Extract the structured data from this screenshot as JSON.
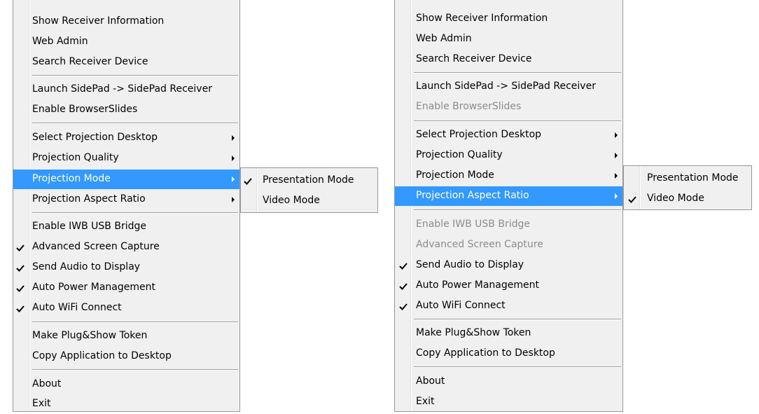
{
  "left_menu": {
    "items": [
      {
        "label": "Show Receiver Information"
      },
      {
        "label": "Web Admin"
      },
      {
        "label": "Search Receiver Device"
      },
      {
        "label": "Launch SidePad -> SidePad Receiver"
      },
      {
        "label": "Enable BrowserSlides"
      },
      {
        "label": "Select Projection Desktop"
      },
      {
        "label": "Projection Quality"
      },
      {
        "label": "Projection Mode"
      },
      {
        "label": "Projection Aspect Ratio"
      },
      {
        "label": "Enable IWB USB Bridge"
      },
      {
        "label": "Advanced Screen Capture",
        "checked": true
      },
      {
        "label": "Send Audio to Display",
        "checked": true
      },
      {
        "label": "Auto Power Management",
        "checked": true
      },
      {
        "label": "Auto WiFi Connect",
        "checked": true
      },
      {
        "label": "Make Plug&Show Token"
      },
      {
        "label": "Copy Application to Desktop"
      },
      {
        "label": "About"
      },
      {
        "label": "Exit"
      }
    ],
    "submenu": [
      {
        "label": "Presentation Mode",
        "checked": true
      },
      {
        "label": "Video Mode"
      }
    ]
  },
  "right_menu": {
    "items": [
      {
        "label": "Show Receiver Information"
      },
      {
        "label": "Web Admin"
      },
      {
        "label": "Search Receiver Device"
      },
      {
        "label": "Launch SidePad -> SidePad Receiver"
      },
      {
        "label": "Enable BrowserSlides",
        "disabled": true
      },
      {
        "label": "Select Projection Desktop"
      },
      {
        "label": "Projection Quality"
      },
      {
        "label": "Projection Mode"
      },
      {
        "label": "Projection Aspect Ratio"
      },
      {
        "label": "Enable IWB USB Bridge",
        "disabled": true
      },
      {
        "label": "Advanced Screen Capture",
        "disabled": true
      },
      {
        "label": "Send Audio to Display",
        "checked": true
      },
      {
        "label": "Auto Power Management",
        "checked": true
      },
      {
        "label": "Auto WiFi Connect",
        "checked": true
      },
      {
        "label": "Make Plug&Show Token"
      },
      {
        "label": "Copy Application to Desktop"
      },
      {
        "label": "About"
      },
      {
        "label": "Exit"
      }
    ],
    "submenu": [
      {
        "label": "Presentation Mode"
      },
      {
        "label": "Video Mode",
        "checked": true
      }
    ]
  },
  "colors": {
    "highlight": "#3399ff",
    "menu_bg": "#f0f0f0",
    "disabled_text": "#8c8c8c"
  }
}
